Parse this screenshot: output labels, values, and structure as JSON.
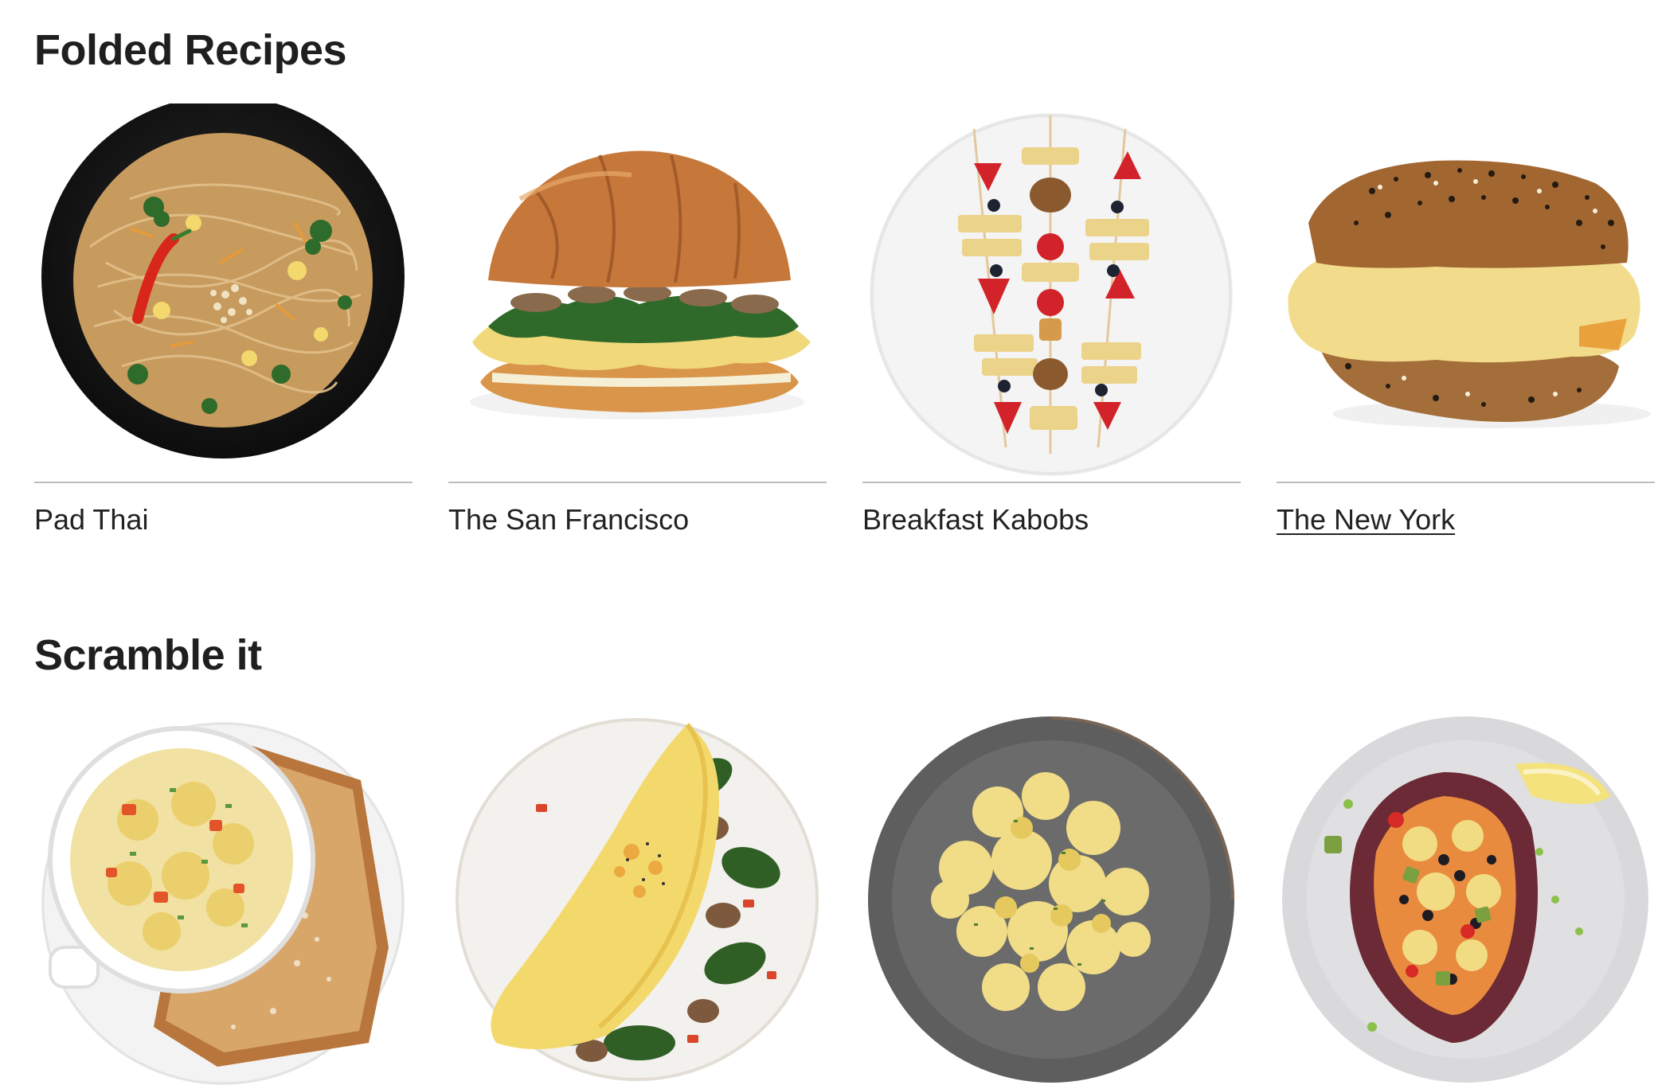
{
  "sections": [
    {
      "title": "Folded Recipes",
      "recipes": [
        {
          "name": "Pad Thai",
          "hovered": false
        },
        {
          "name": "The San Francisco",
          "hovered": false
        },
        {
          "name": "Breakfast Kabobs",
          "hovered": false
        },
        {
          "name": "The New York",
          "hovered": true
        }
      ]
    },
    {
      "title": "Scramble it",
      "recipes": [
        {
          "image": "mug-scramble-with-toast"
        },
        {
          "image": "spinach-mushroom-omelet"
        },
        {
          "image": "scrambled-eggs-gray-plate"
        },
        {
          "image": "stuffed-sweet-potato"
        }
      ]
    }
  ],
  "colors": {
    "text": "#222222",
    "divider": "#bdbdbd",
    "background": "#ffffff"
  }
}
